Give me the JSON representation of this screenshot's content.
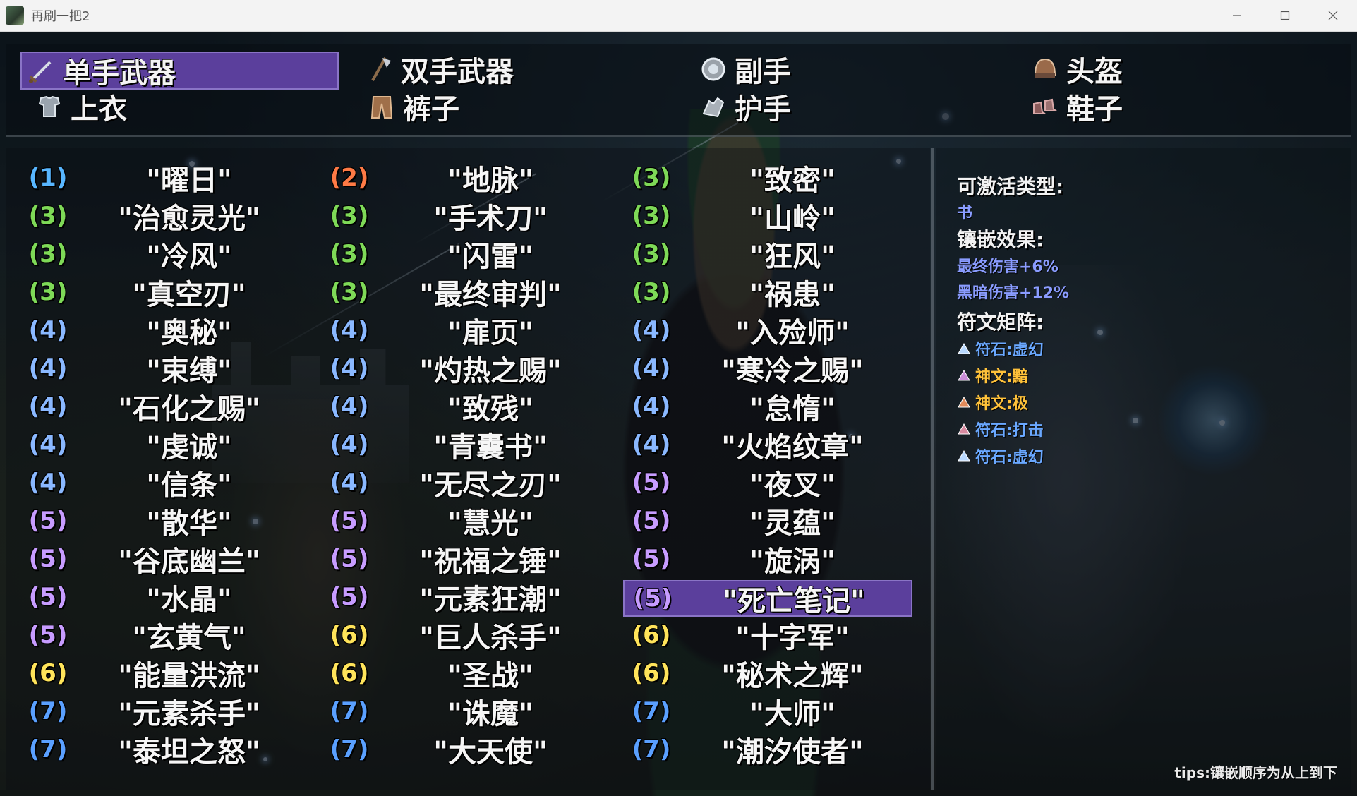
{
  "window": {
    "title": "再刷一把2",
    "minimize_icon": "minimize-icon",
    "maximize_icon": "maximize-icon",
    "close_icon": "close-icon"
  },
  "tabs": [
    {
      "label": "单手武器",
      "icon": "sword-icon",
      "active": true
    },
    {
      "label": "双手武器",
      "icon": "axe-icon",
      "active": false
    },
    {
      "label": "副手",
      "icon": "orb-icon",
      "active": false
    },
    {
      "label": "头盔",
      "icon": "helmet-icon",
      "active": false
    },
    {
      "label": "上衣",
      "icon": "armor-icon",
      "active": false
    },
    {
      "label": "裤子",
      "icon": "pants-icon",
      "active": false
    },
    {
      "label": "护手",
      "icon": "gauntlet-icon",
      "active": false
    },
    {
      "label": "鞋子",
      "icon": "boots-icon",
      "active": false
    }
  ],
  "colors": {
    "1": "#58b6ff",
    "2": "#ff7a45",
    "3": "#7ed957",
    "4": "#8ab8ff",
    "5": "#c79cff",
    "6": "#ffe45a",
    "7": "#5aa0ff",
    "selected_bg": "#5b3f9c"
  },
  "columns": [
    [
      {
        "num": "(1)",
        "name": "\"曜日\""
      },
      {
        "num": "(3)",
        "name": "\"治愈灵光\""
      },
      {
        "num": "(3)",
        "name": "\"冷风\""
      },
      {
        "num": "(3)",
        "name": "\"真空刃\""
      },
      {
        "num": "(4)",
        "name": "\"奥秘\""
      },
      {
        "num": "(4)",
        "name": "\"束缚\""
      },
      {
        "num": "(4)",
        "name": "\"石化之赐\""
      },
      {
        "num": "(4)",
        "name": "\"虔诚\""
      },
      {
        "num": "(4)",
        "name": "\"信条\""
      },
      {
        "num": "(5)",
        "name": "\"散华\""
      },
      {
        "num": "(5)",
        "name": "\"谷底幽兰\""
      },
      {
        "num": "(5)",
        "name": "\"水晶\""
      },
      {
        "num": "(5)",
        "name": "\"玄黄气\""
      },
      {
        "num": "(6)",
        "name": "\"能量洪流\""
      },
      {
        "num": "(7)",
        "name": "\"元素杀手\""
      },
      {
        "num": "(7)",
        "name": "\"泰坦之怒\""
      }
    ],
    [
      {
        "num": "(2)",
        "name": "\"地脉\""
      },
      {
        "num": "(3)",
        "name": "\"手术刀\""
      },
      {
        "num": "(3)",
        "name": "\"闪雷\""
      },
      {
        "num": "(3)",
        "name": "\"最终审判\""
      },
      {
        "num": "(4)",
        "name": "\"扉页\""
      },
      {
        "num": "(4)",
        "name": "\"灼热之赐\""
      },
      {
        "num": "(4)",
        "name": "\"致残\""
      },
      {
        "num": "(4)",
        "name": "\"青囊书\""
      },
      {
        "num": "(4)",
        "name": "\"无尽之刃\""
      },
      {
        "num": "(5)",
        "name": "\"慧光\""
      },
      {
        "num": "(5)",
        "name": "\"祝福之锤\""
      },
      {
        "num": "(5)",
        "name": "\"元素狂潮\""
      },
      {
        "num": "(6)",
        "name": "\"巨人杀手\""
      },
      {
        "num": "(6)",
        "name": "\"圣战\""
      },
      {
        "num": "(7)",
        "name": "\"诛魔\""
      },
      {
        "num": "(7)",
        "name": "\"大天使\""
      }
    ],
    [
      {
        "num": "(3)",
        "name": "\"致密\""
      },
      {
        "num": "(3)",
        "name": "\"山岭\""
      },
      {
        "num": "(3)",
        "name": "\"狂风\""
      },
      {
        "num": "(3)",
        "name": "\"祸患\""
      },
      {
        "num": "(4)",
        "name": "\"入殓师\""
      },
      {
        "num": "(4)",
        "name": "\"寒冷之赐\""
      },
      {
        "num": "(4)",
        "name": "\"怠惰\""
      },
      {
        "num": "(4)",
        "name": "\"火焰纹章\""
      },
      {
        "num": "(5)",
        "name": "\"夜叉\""
      },
      {
        "num": "(5)",
        "name": "\"灵蕴\""
      },
      {
        "num": "(5)",
        "name": "\"旋涡\""
      },
      {
        "num": "(5)",
        "name": "\"死亡笔记\"",
        "selected": true
      },
      {
        "num": "(6)",
        "name": "\"十字军\""
      },
      {
        "num": "(6)",
        "name": "\"秘术之辉\""
      },
      {
        "num": "(7)",
        "name": "\"大师\""
      },
      {
        "num": "(7)",
        "name": "\"潮汐使者\""
      }
    ]
  ],
  "info": {
    "activatable_heading": "可激活类型:",
    "activatable_value": "书",
    "effect_heading": "镶嵌效果:",
    "effects": [
      "最终伤害+6%",
      "黑暗伤害+12%"
    ],
    "matrix_heading": "符文矩阵:",
    "runes": [
      {
        "label": "符石:虚幻",
        "color": "#6aa8ff",
        "icon_color": "#b8d8ff"
      },
      {
        "label": "神文:黯",
        "color": "#ffc23a",
        "icon_color": "#c98bd6"
      },
      {
        "label": "神文:极",
        "color": "#ffc23a",
        "icon_color": "#e08a5a"
      },
      {
        "label": "符石:打击",
        "color": "#6aa8ff",
        "icon_color": "#d88aa0"
      },
      {
        "label": "符石:虚幻",
        "color": "#6aa8ff",
        "icon_color": "#b8d8ff"
      }
    ],
    "effect_color": "#8a9cff",
    "activatable_color": "#8a9cff"
  },
  "tips": "tips:镶嵌顺序为从上到下"
}
